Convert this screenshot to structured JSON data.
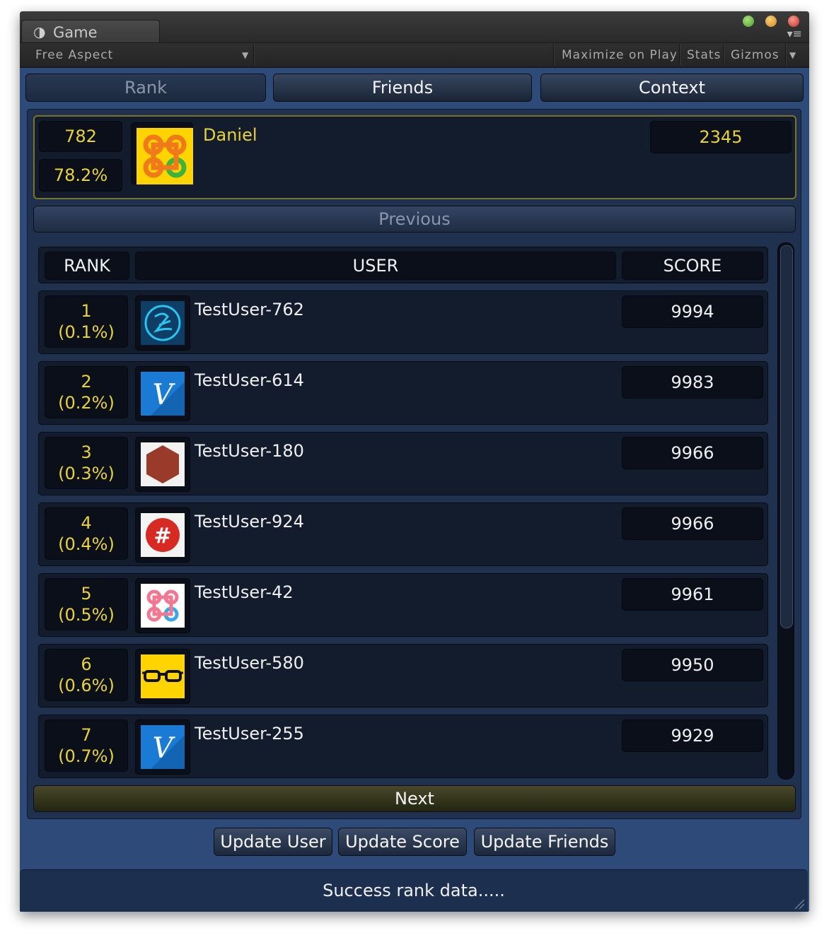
{
  "titlebar": {
    "tab_label": "Game",
    "tab_icon": "unity-game-icon",
    "traffic_lights": [
      "#5cb838",
      "#e5a532",
      "#e0463c"
    ]
  },
  "toolbar": {
    "aspect": "Free Aspect",
    "maximize": "Maximize on Play",
    "stats": "Stats",
    "gizmos": "Gizmos"
  },
  "tabs": {
    "rank": "Rank",
    "friends": "Friends",
    "context": "Context"
  },
  "self": {
    "rank": "782",
    "percent": "78.2%",
    "name": "Daniel",
    "score": "2345",
    "avatar": "command-key-icon"
  },
  "nav": {
    "previous": "Previous",
    "next": "Next"
  },
  "table": {
    "headers": {
      "rank": "RANK",
      "user": "USER",
      "score": "SCORE"
    },
    "rows": [
      {
        "rank": "1",
        "percent": "(0.1%)",
        "user": "TestUser-762",
        "score": "9994",
        "avatar": "signature-circle-icon"
      },
      {
        "rank": "2",
        "percent": "(0.2%)",
        "user": "TestUser-614",
        "score": "9983",
        "avatar": "letter-v-icon"
      },
      {
        "rank": "3",
        "percent": "(0.3%)",
        "user": "TestUser-180",
        "score": "9966",
        "avatar": "hexagon-icon"
      },
      {
        "rank": "4",
        "percent": "(0.4%)",
        "user": "TestUser-924",
        "score": "9966",
        "avatar": "hashtag-icon"
      },
      {
        "rank": "5",
        "percent": "(0.5%)",
        "user": "TestUser-42",
        "score": "9961",
        "avatar": "command-key-icon"
      },
      {
        "rank": "6",
        "percent": "(0.6%)",
        "user": "TestUser-580",
        "score": "9950",
        "avatar": "glasses-icon"
      },
      {
        "rank": "7",
        "percent": "(0.7%)",
        "user": "TestUser-255",
        "score": "9929",
        "avatar": "letter-v-icon"
      }
    ]
  },
  "actions": {
    "update_user": "Update User",
    "update_score": "Update Score",
    "update_friends": "Update Friends"
  },
  "status": "Success rank data....."
}
